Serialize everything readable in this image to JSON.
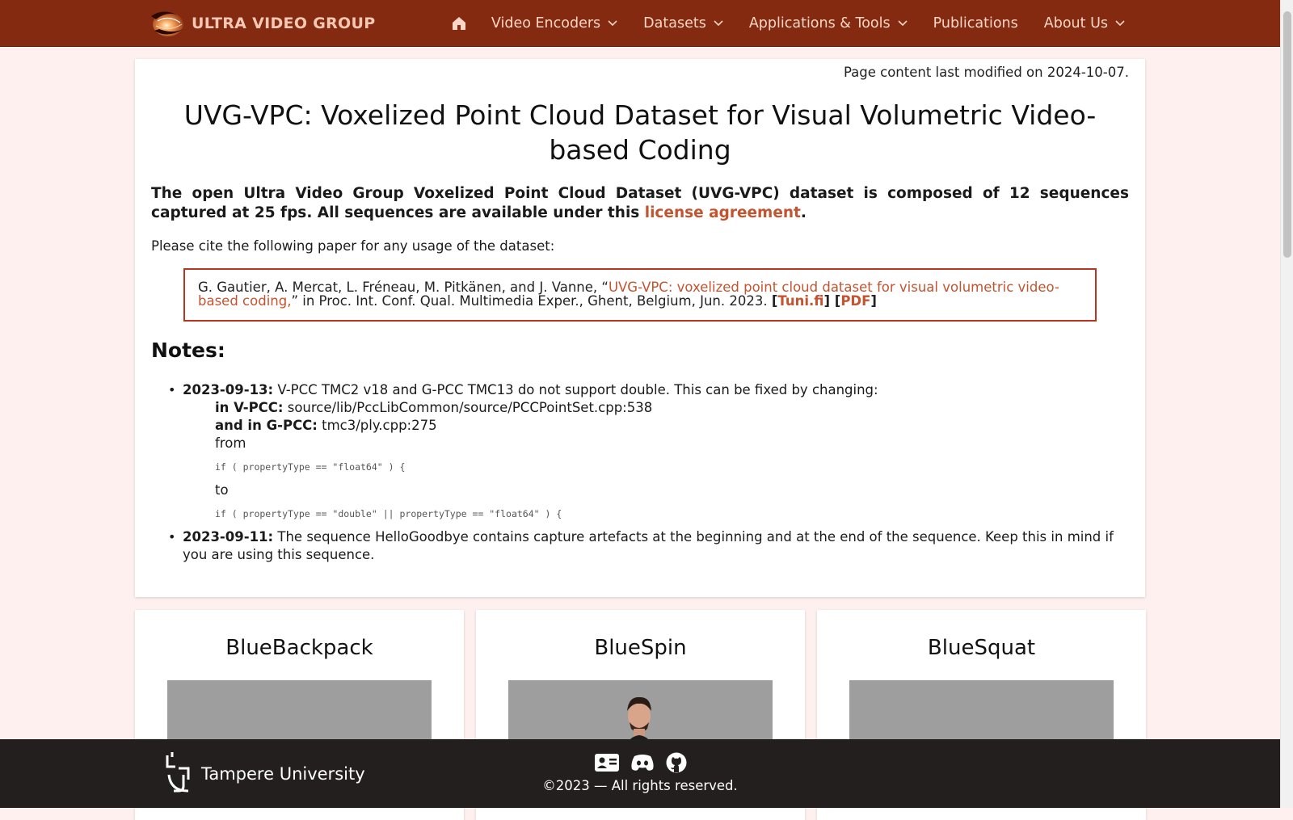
{
  "nav": {
    "logo_text": "ULTRA VIDEO GROUP",
    "items": [
      {
        "label": "Video Encoders",
        "dropdown": true
      },
      {
        "label": "Datasets",
        "dropdown": true
      },
      {
        "label": "Applications & Tools",
        "dropdown": true
      },
      {
        "label": "Publications",
        "dropdown": false
      },
      {
        "label": "About Us",
        "dropdown": true
      }
    ]
  },
  "main": {
    "modified": "Page content last modified on 2024-10-07.",
    "title": "UVG-VPC: Voxelized Point Cloud Dataset for Visual Volumetric Video-based Coding",
    "lead_text": "The open Ultra Video Group Voxelized Point Cloud Dataset (UVG-VPC) dataset is composed of 12 sequences captured at 25 fps. All sequences are available under this ",
    "lead_link": "license agreement",
    "lead_end": ".",
    "cite_intro": "Please cite the following paper for any usage of the dataset:",
    "citation": {
      "authors": "G. Gautier, A. Mercat, L. Fréneau, M. Pitkänen, and J. Vanne, “",
      "paper_link": "UVG-VPC: voxelized point cloud dataset for visual volumetric video-based coding,",
      "venue": "” in Proc. Int. Conf. Qual. Multimedia Exper., Ghent, Belgium, Jun. 2023. ",
      "link1": "Tuni.fi",
      "link2": "PDF"
    },
    "notes_heading": "Notes:",
    "notes": [
      {
        "date": "2023-09-13:",
        "text": " V-PCC TMC2 v18 and G-PCC TMC13 do not support double. This can be fixed by changing:",
        "vpcc_label": "in V-PCC:",
        "vpcc_path": " source/lib/PccLibCommon/source/PCCPointSet.cpp:538",
        "gpcc_label": "and in G-PCC:",
        "gpcc_path": " tmc3/ply.cpp:275",
        "from": "from",
        "code_from": "if ( propertyType == \"float64\" ) {",
        "to": "to",
        "code_to": "if ( propertyType == \"double\" || propertyType == \"float64\" ) {"
      },
      {
        "date": "2023-09-11:",
        "text": " The sequence HelloGoodbye contains capture artefacts at the beginning and at the end of the sequence. Keep this in mind if you are using this sequence."
      }
    ]
  },
  "sequences": [
    {
      "name": "BlueBackpack"
    },
    {
      "name": "BlueSpin"
    },
    {
      "name": "BlueSquat"
    }
  ],
  "footer": {
    "university": "Tampere University",
    "copyright": "©2023 — All rights reserved."
  },
  "colors": {
    "nav_bg": "#832a10",
    "accent": "#c3542f",
    "cite_border": "#b9351f",
    "footer_bg": "#231f1e"
  }
}
